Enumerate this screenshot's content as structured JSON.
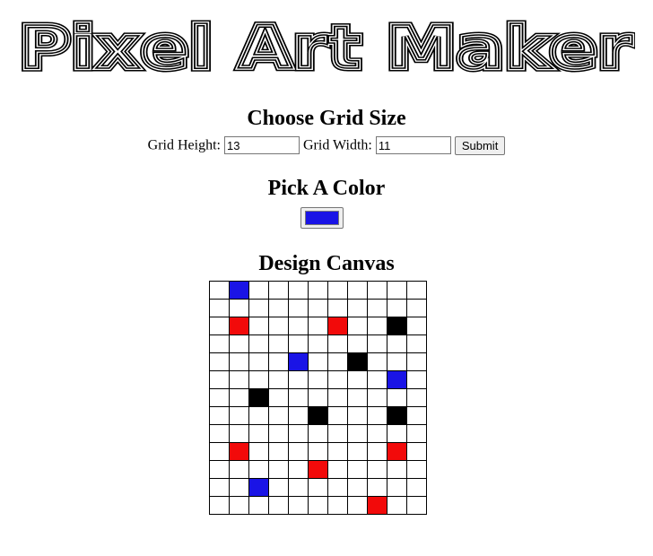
{
  "logo": {
    "text": "Pixel Art Maker"
  },
  "grid_size": {
    "heading": "Choose Grid Size",
    "height_label": "Grid Height:",
    "height_value": "13",
    "width_label": "Grid Width:",
    "width_value": "11",
    "submit_label": "Submit"
  },
  "color": {
    "heading": "Pick A Color",
    "selected": "#1a14e6"
  },
  "canvas": {
    "heading": "Design Canvas",
    "rows": 13,
    "cols": 11,
    "palette": {
      "B": "#1a14e6",
      "R": "#f20a0a",
      "K": "#000000"
    },
    "cells": [
      ".B.........",
      "...........",
      ".R....R..K.",
      "...........",
      "....B..K...",
      ".........B.",
      "..K........",
      ".....K...K.",
      "...........",
      ".R.......R.",
      ".....R.....",
      "..B........",
      "........R.."
    ]
  }
}
